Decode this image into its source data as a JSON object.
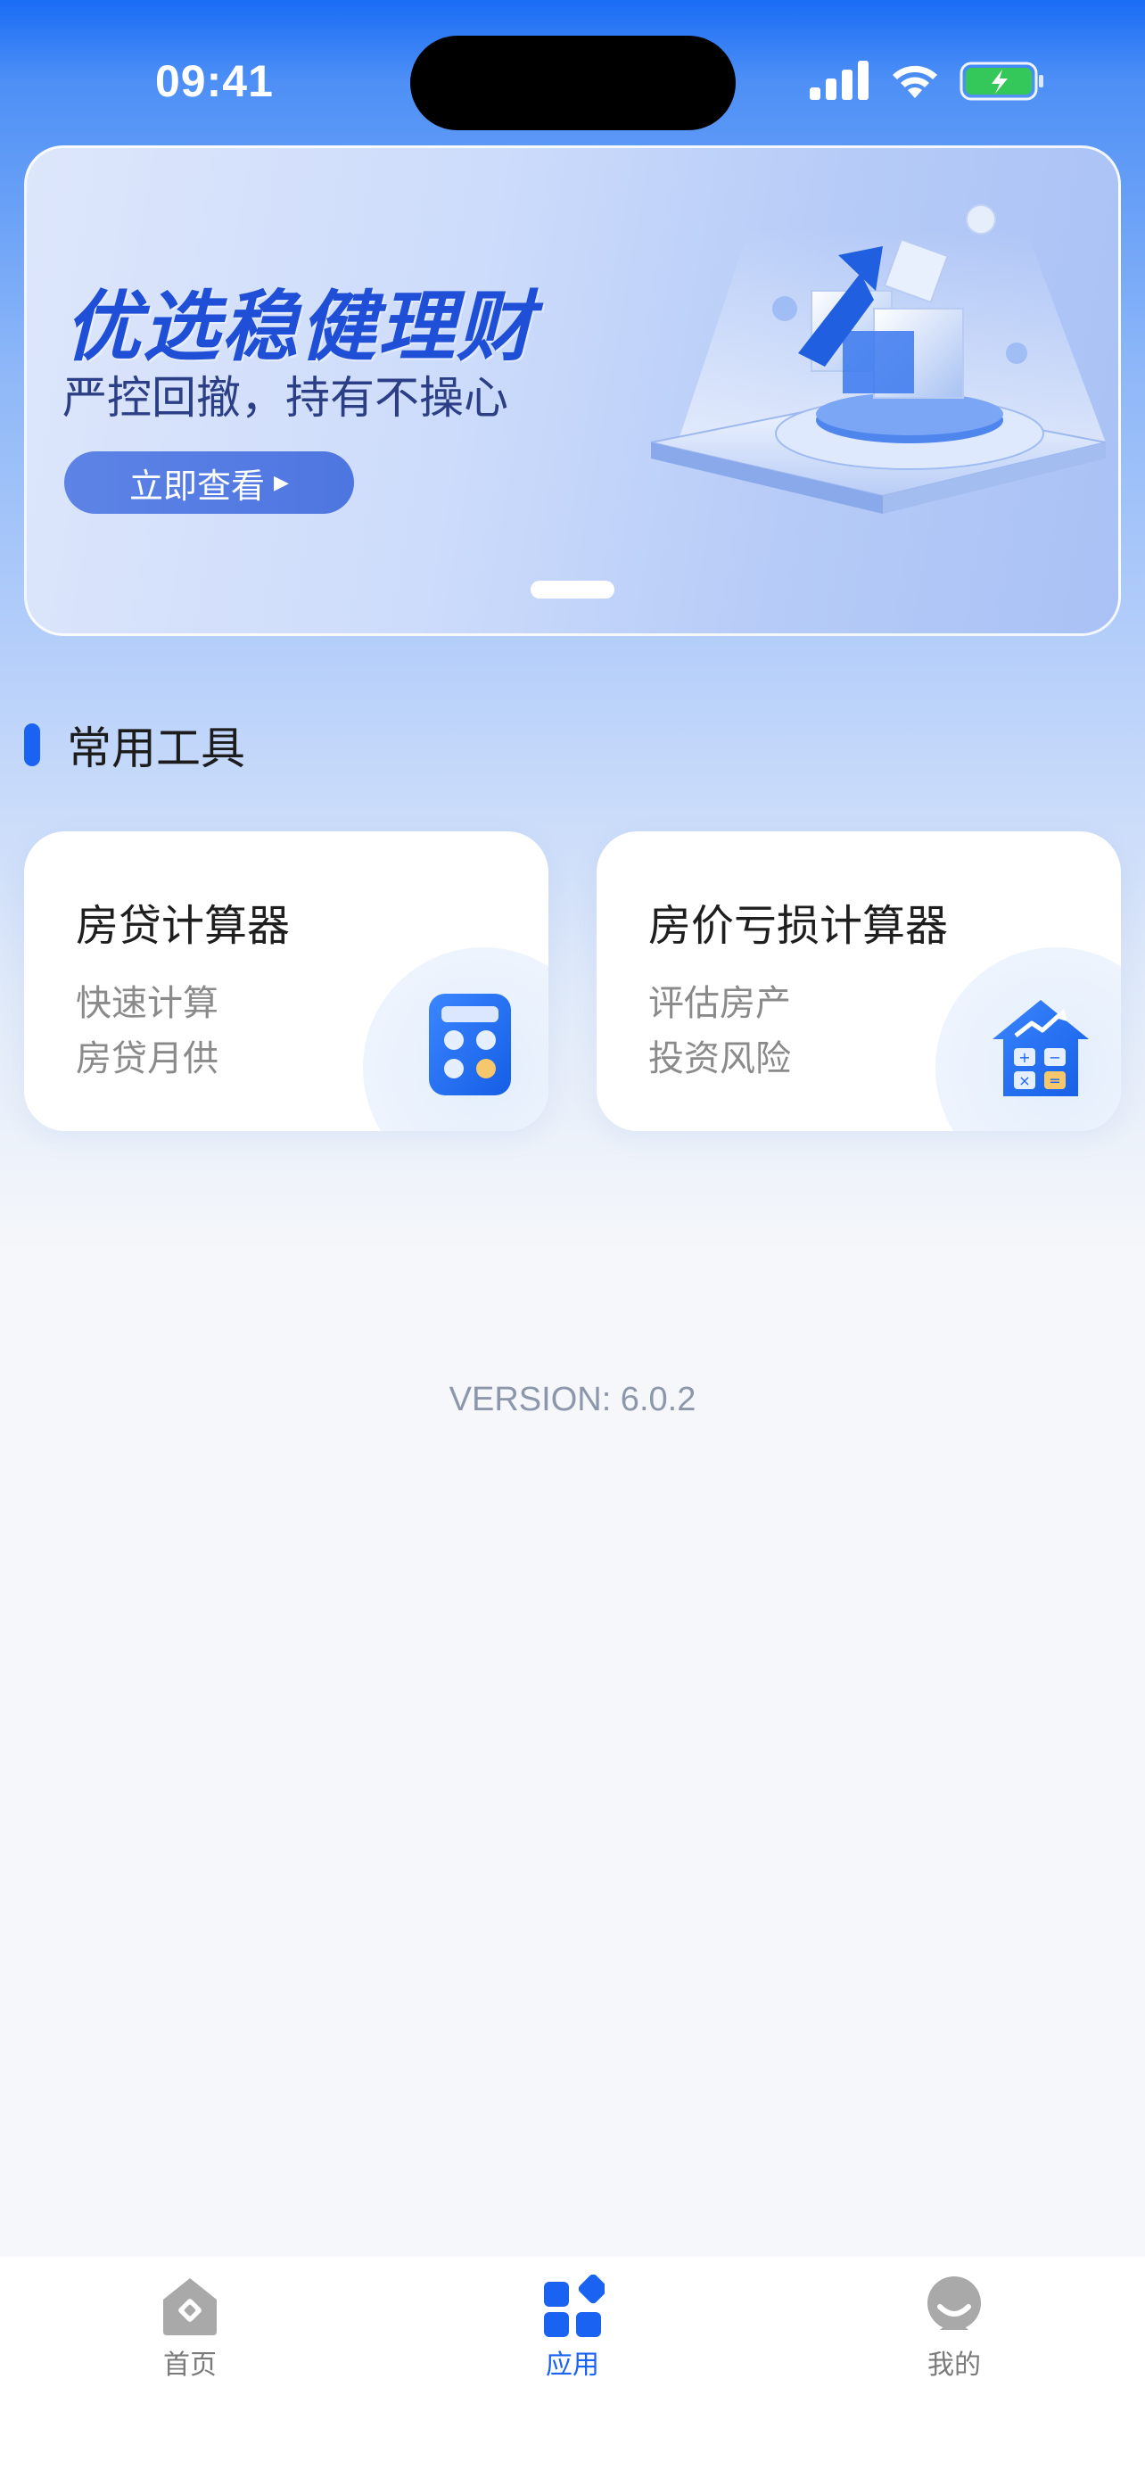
{
  "status_bar": {
    "time": "09:41"
  },
  "banner": {
    "title": "优选稳健理财",
    "subtitle": "严控回撤，持有不操心",
    "button_label": "立即查看"
  },
  "section": {
    "title": "常用工具"
  },
  "tools": [
    {
      "title": "房贷计算器",
      "desc_line1": "快速计算",
      "desc_line2": "房贷月供",
      "icon": "calculator-icon"
    },
    {
      "title": "房价亏损计算器",
      "desc_line1": "评估房产",
      "desc_line2": "投资风险",
      "icon": "house-chart-icon"
    }
  ],
  "version": "VERSION: 6.0.2",
  "tab_bar": {
    "tabs": [
      {
        "label": "首页",
        "icon": "home-icon",
        "active": false
      },
      {
        "label": "应用",
        "icon": "apps-icon",
        "active": true
      },
      {
        "label": "我的",
        "icon": "profile-icon",
        "active": false
      }
    ]
  },
  "colors": {
    "accent": "#1a63f2",
    "banner_title": "#1f4fd6"
  }
}
